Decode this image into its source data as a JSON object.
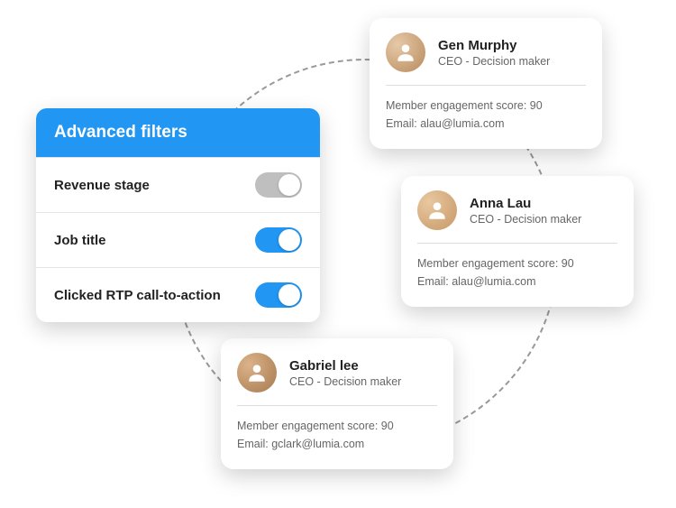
{
  "filters": {
    "title": "Advanced filters",
    "items": [
      {
        "label": "Revenue stage",
        "on": false
      },
      {
        "label": "Job title",
        "on": true
      },
      {
        "label": "Clicked RTP call-to-action",
        "on": true
      }
    ]
  },
  "contacts": [
    {
      "name": "Gen Murphy",
      "role": "CEO - Decision maker",
      "score_line": "Member engagement score: 90",
      "email_line": "Email: alau@lumia.com"
    },
    {
      "name": "Anna Lau",
      "role": "CEO - Decision maker",
      "score_line": "Member engagement score: 90",
      "email_line": "Email: alau@lumia.com"
    },
    {
      "name": "Gabriel lee",
      "role": "CEO - Decision maker",
      "score_line": "Member engagement score: 90",
      "email_line": "Email: gclark@lumia.com"
    }
  ]
}
